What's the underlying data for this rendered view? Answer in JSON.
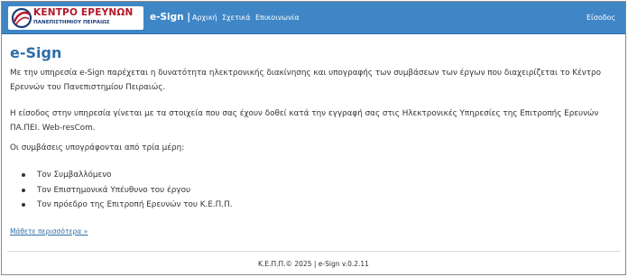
{
  "logo": {
    "line1": "ΚΕΝΤΡΟ ΕΡΕΥΝΩΝ",
    "line2": "ΠΑΝΕΠΙΣΤΗΜΙΟΥ ΠΕΙΡΑΙΩΣ",
    "colors": {
      "red": "#b3182a",
      "blue": "#1c3f7a"
    }
  },
  "navbar": {
    "brand": "e-Sign |",
    "links": [
      "Αρχική",
      "Σχετικά",
      "Επικοινωνία"
    ],
    "login": "Είσοδος",
    "background": "#3f86c6"
  },
  "main": {
    "title": "e-Sign",
    "paragraph1": "Με την υπηρεσία e-Sign παρέχεται η δυνατότητα ηλεκτρονικής διακίνησης και υπογραφής των συμβάσεων των έργων που διαχειρίζεται το Κέντρο Ερευνών του Πανεπιστημίου Πειραιώς.",
    "paragraph2_prefix": "Η είσοδος στην υπηρεσία γίνεται με τα στοιχεία που σας έχουν δοθεί κατά την εγγραφή σας στις Ηλεκτρονικές Υπηρεσίες της Επιτροπής Ερευνών ΠΑ.ΠΕΙ.",
    "paragraph2_link": "Web-resCom.",
    "paragraph3": "Οι συμβάσεις υπογράφονται από τρία μέρη:",
    "parties": [
      "Τον Συμβαλλόμενο",
      "Τον Επιστημονικά Υπέυθυνο του έργου",
      "Τον πρόεδρο της Επιτροπή Ερευνών του Κ.Ε.Π.Π."
    ],
    "more_link": "Μάθετε περισσότερα »",
    "accent": "#2e6da8"
  },
  "footer": {
    "text": "Κ.Ε.Π.Π.© 2025 | e-Sign  v.0.2.11"
  }
}
